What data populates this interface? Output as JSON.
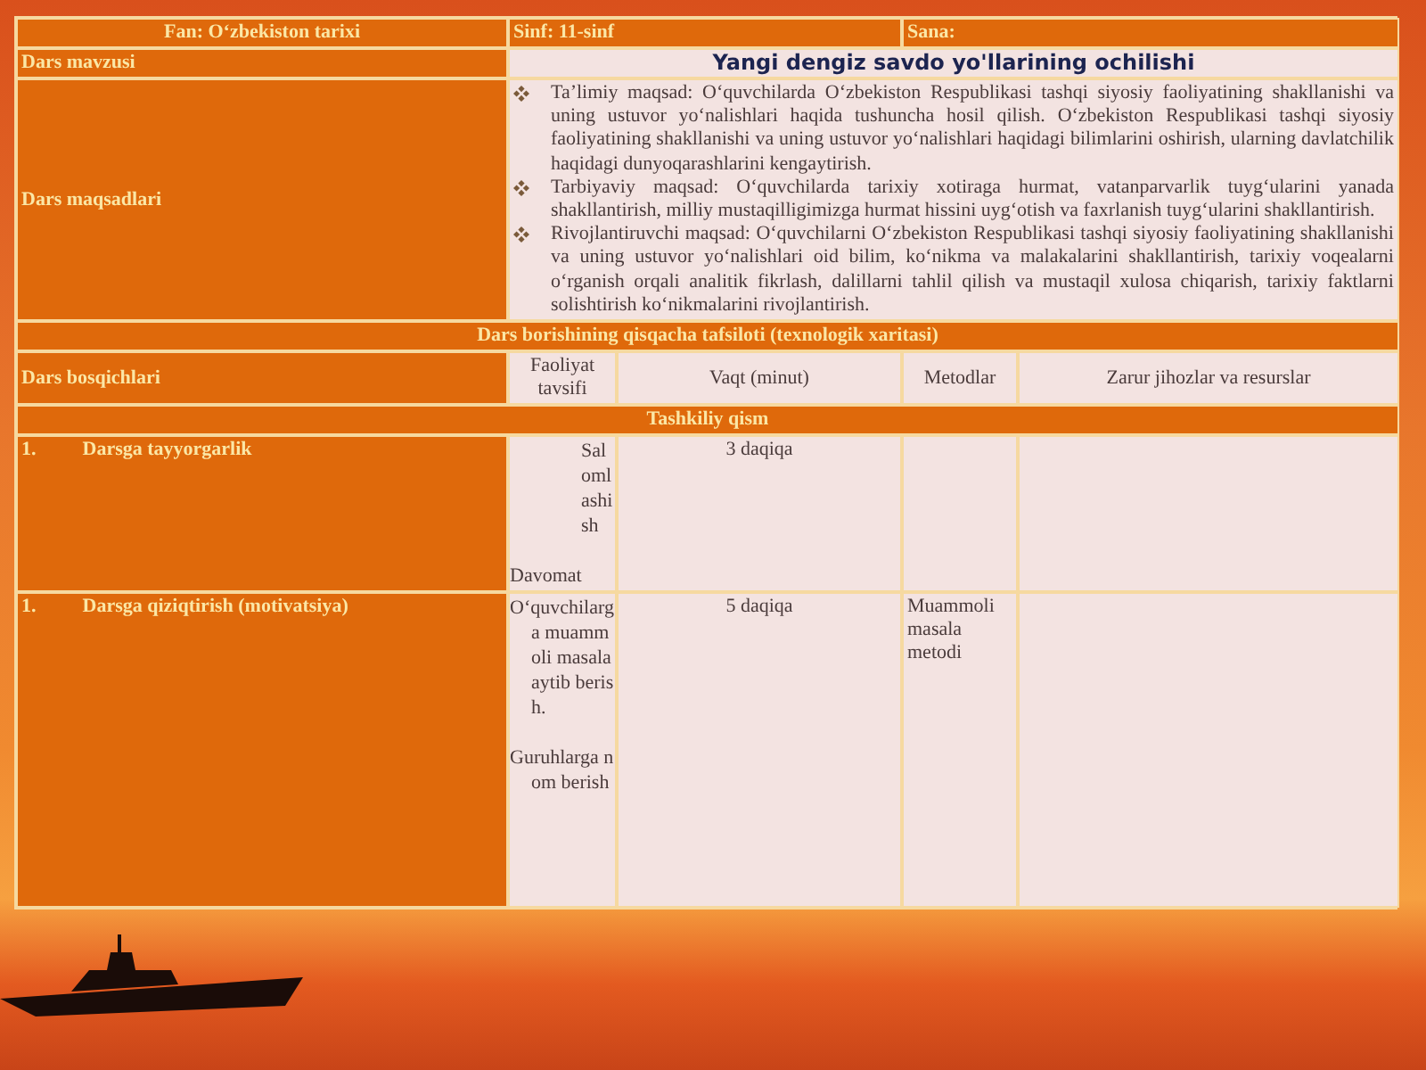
{
  "header": [
    {
      "label": "Fan: O‘zbekiston tarixi"
    },
    {
      "label": "Sinf: 11-sinf"
    },
    {
      "label": "Sana:"
    }
  ],
  "topic": {
    "label": "Dars mavzusi",
    "value": "Yangi dengiz savdo yo'llarining ochilishi"
  },
  "goals": {
    "label": "Dars maqsadlari",
    "items": [
      "Ta’limiy maqsad: O‘quvchilarda O‘zbekiston Respublikasi tashqi siyosiy faoliyatining shakllanishi va uning ustuvor yo‘nalishlari haqida tushuncha hosil qilish. O‘zbekiston Respublikasi tashqi siyosiy faoliyatining shakllanishi va uning ustuvor yo‘nalishlari haqidagi bilimlarini oshirish, ularning davlatchilik haqidagi dunyoqarashlarini kengaytirish.",
      "Tarbiyaviy maqsad: O‘quvchilarda tarixiy xotiraga hurmat, vatanparvarlik tuyg‘ularini yanada shakllantirish, milliy mustaqilligimizga hurmat hissini uyg‘otish va faxrlanish tuyg‘ularini shakllantirish.",
      "Rivojlantiruvchi maqsad: O‘quvchilarni O‘zbekiston Respublikasi tashqi siyosiy faoliyatining shakllanishi va uning ustuvor yo‘nalishlari oid bilim, ko‘nikma va malakalarini shakllantirish, tarixiy voqealarni o‘rganish orqali analitik fikrlash, dalillarni tahlil qilish va mustaqil xulosa chiqarish, tarixiy faktlarni solishtirish ko‘nikmalarini rivojlantirish."
    ]
  },
  "section_title": "Dars borishining qisqacha tafsiloti (texnologik xaritasi)",
  "columns": [
    "Dars bosqichlari",
    "Faoliyat tavsifi",
    "Vaqt (minut)",
    "Metodlar",
    "Zarur jihozlar va resurslar"
  ],
  "part_title": "Tashkiliy qism",
  "stages": [
    {
      "number": "1.",
      "name": "Darsga tayyorgarlik",
      "activities": [
        "Salomlashish",
        "Davomat"
      ],
      "time": "3 daqiqa"
    },
    {
      "number": "1.",
      "name": "Darsga qiziqtirish (motivatsiya)",
      "activities": [
        "O‘quvchilarga muammoli masala aytib berish.",
        "Guruhlarga nom berish"
      ],
      "time": "5 daqiqa",
      "methods": "Muammoli masala metodi"
    }
  ]
}
